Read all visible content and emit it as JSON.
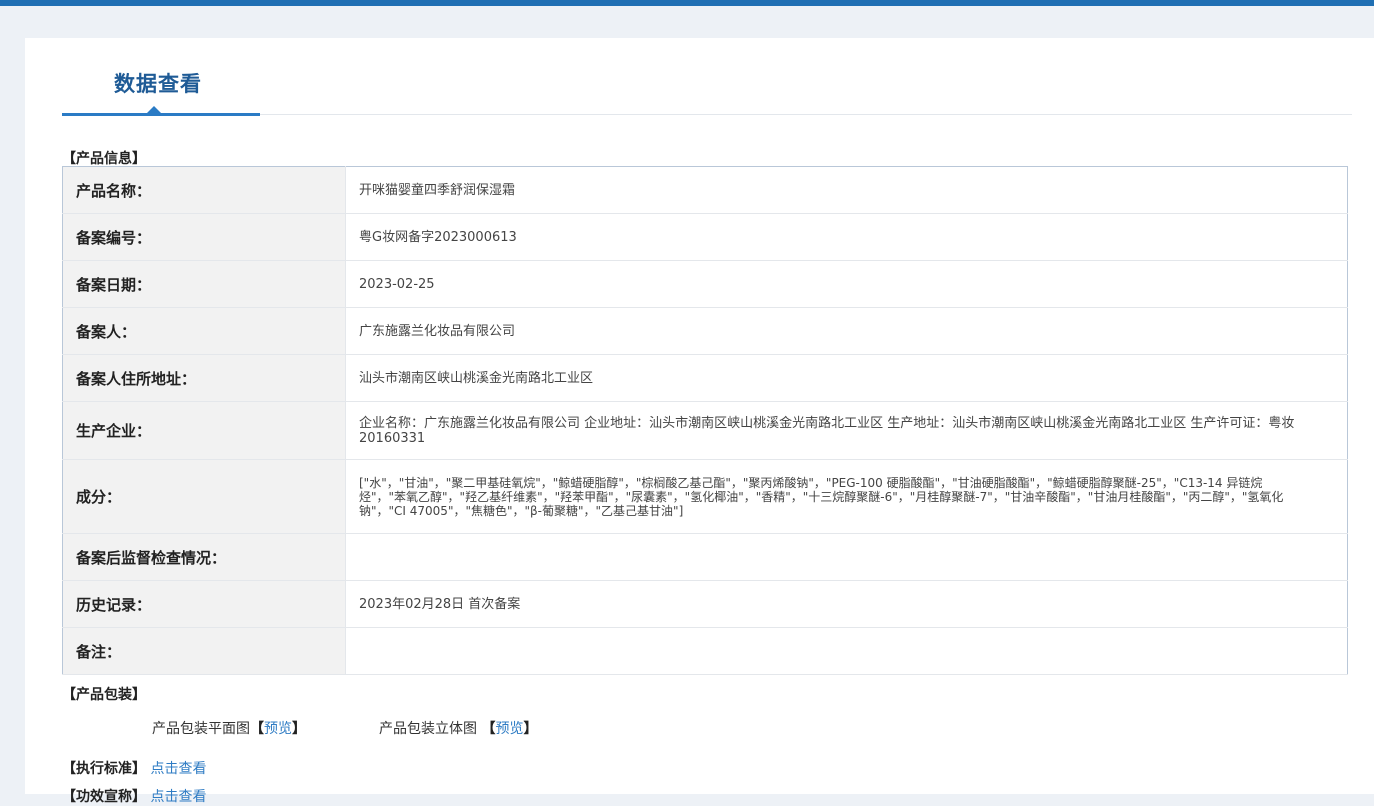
{
  "header": {
    "tab_title": "数据查看"
  },
  "product_info": {
    "section_label": "【产品信息】",
    "rows": [
      {
        "label": "产品名称：",
        "value": "开咪猫婴童四季舒润保湿霜"
      },
      {
        "label": "备案编号：",
        "value": "粤G妆网备字2023000613"
      },
      {
        "label": "备案日期：",
        "value": "2023-02-25"
      },
      {
        "label": "备案人：",
        "value": "广东施露兰化妆品有限公司"
      },
      {
        "label": "备案人住所地址：",
        "value": "汕头市潮南区峡山桃溪金光南路北工业区"
      },
      {
        "label": "生产企业：",
        "value": "企业名称：广东施露兰化妆品有限公司 企业地址：汕头市潮南区峡山桃溪金光南路北工业区 生产地址：汕头市潮南区峡山桃溪金光南路北工业区 生产许可证：粤妆20160331"
      },
      {
        "label": "成分：",
        "value": "[\"水\"，\"甘油\"，\"聚二甲基硅氧烷\"，\"鲸蜡硬脂醇\"，\"棕榈酸乙基己酯\"，\"聚丙烯酸钠\"，\"PEG-100 硬脂酸酯\"，\"甘油硬脂酸酯\"，\"鲸蜡硬脂醇聚醚-25\"，\"C13-14 异链烷烃\"，\"苯氧乙醇\"，\"羟乙基纤维素\"，\"羟苯甲酯\"，\"尿囊素\"，\"氢化椰油\"，\"香精\"，\"十三烷醇聚醚-6\"，\"月桂醇聚醚-7\"，\"甘油辛酸酯\"，\"甘油月桂酸酯\"，\"丙二醇\"，\"氢氧化钠\"，\"CI 47005\"，\"焦糖色\"，\"β-葡聚糖\"，\"乙基己基甘油\"]"
      },
      {
        "label": "备案后监督检查情况：",
        "value": ""
      },
      {
        "label": "历史记录：",
        "value": "2023年02月28日 首次备案"
      },
      {
        "label": "备注：",
        "value": ""
      }
    ]
  },
  "packaging": {
    "section_label": "【产品包装】",
    "flat_label": "产品包装平面图",
    "stereo_label": "产品包装立体图",
    "bracket_open": "【",
    "bracket_close": "】",
    "preview_link": "预览"
  },
  "standard": {
    "label": "【执行标准】",
    "link": "点击查看"
  },
  "efficacy": {
    "label": "【功效宣称】",
    "link": "点击查看"
  }
}
